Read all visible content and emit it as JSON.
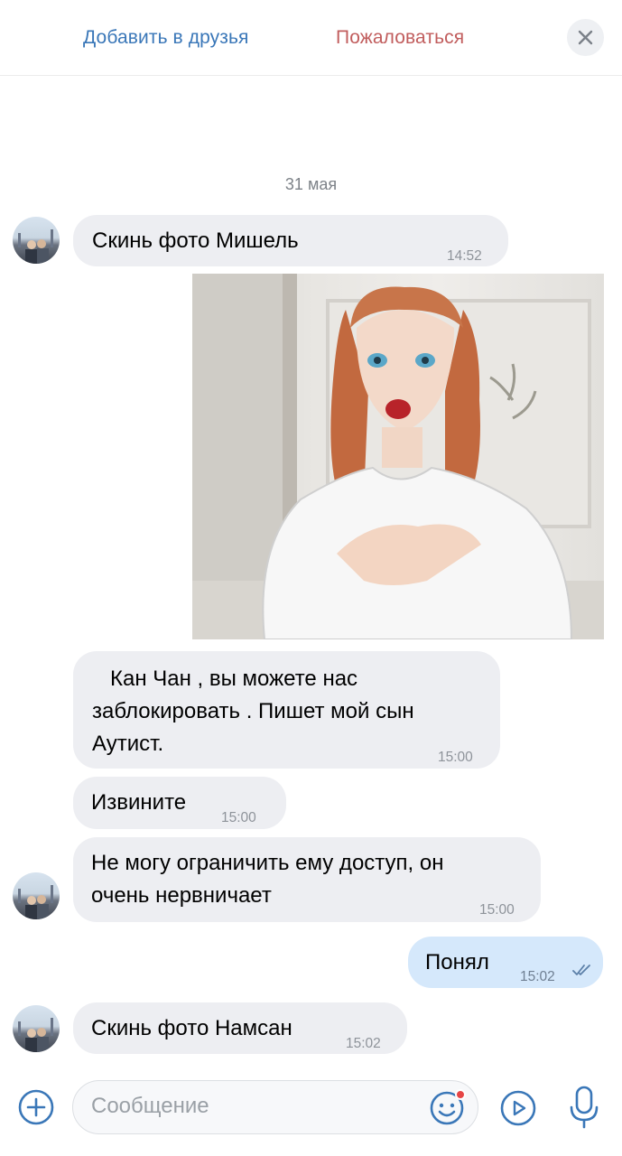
{
  "header": {
    "add_friend": "Добавить в друзья",
    "report": "Пожаловаться"
  },
  "chat": {
    "date_separator": "31 мая",
    "messages": [
      {
        "direction": "incoming",
        "text": "Скинь фото Мишель",
        "time": "14:52"
      },
      {
        "direction": "incoming",
        "type": "photo",
        "description": "anime-style red-haired woman in white t-shirt"
      },
      {
        "direction": "incoming",
        "lines": [
          "   Кан Чан , вы можете нас",
          "заблокировать . Пишет мой сын",
          "Аутист."
        ],
        "time": "15:00"
      },
      {
        "direction": "incoming",
        "text": "Извините",
        "time": "15:00"
      },
      {
        "direction": "incoming",
        "lines": [
          "Не могу ограничить ему доступ, он",
          "очень нервничает"
        ],
        "time": "15:00"
      },
      {
        "direction": "outgoing",
        "text": "Понял",
        "time": "15:02",
        "status": "read-double-check"
      },
      {
        "direction": "incoming",
        "text": "Скинь фото Намсан",
        "time": "15:02"
      }
    ]
  },
  "composer": {
    "placeholder": "Сообщение"
  },
  "colors": {
    "link_blue": "#3a77b8",
    "report_red": "#c15d5d",
    "incoming_bubble": "#edeef2",
    "outgoing_bubble": "#d5e8fb",
    "icon_blue": "#3a77b8"
  },
  "icons": [
    "close-icon",
    "plus-icon",
    "emoji-icon",
    "video-message-icon",
    "microphone-icon",
    "double-check-icon"
  ]
}
